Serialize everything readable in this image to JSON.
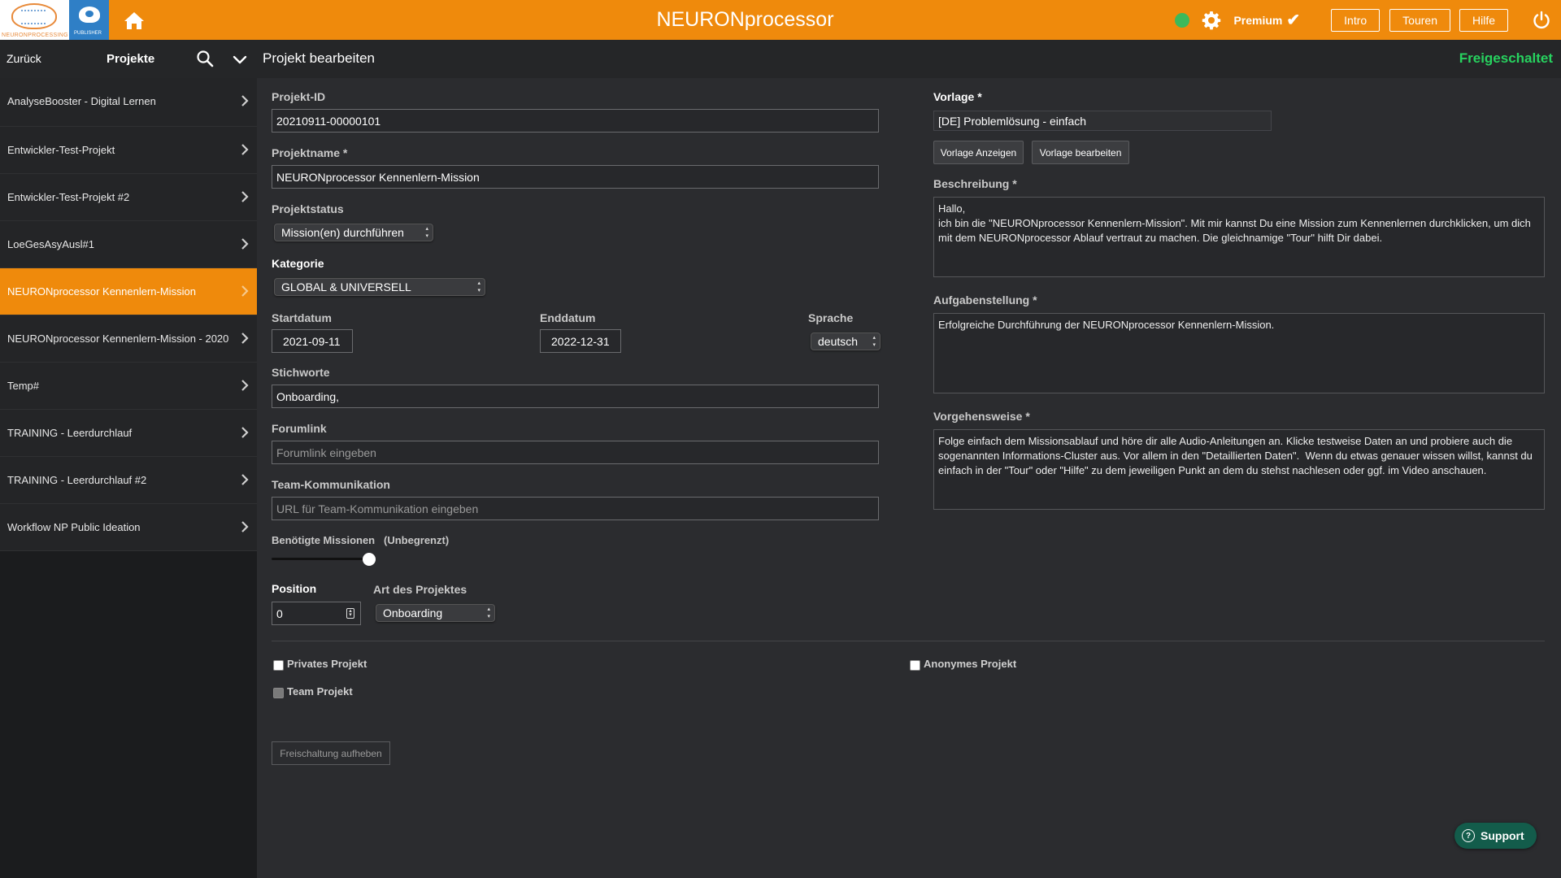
{
  "topbar": {
    "logo_text": "NEURONPROCESSING",
    "publisher_text": "PUBLISHER",
    "title": "NEURONprocessor",
    "premium_label": "Premium",
    "buttons": [
      "Intro",
      "Touren",
      "Hilfe"
    ],
    "status_color": "#3cb95b",
    "accent_color": "#ef8a0c"
  },
  "subbar": {
    "back_label": "Zurück",
    "projects_label": "Projekte",
    "page_title": "Projekt bearbeiten",
    "state_label": "Freigeschaltet",
    "state_color": "#27d25f"
  },
  "sidebar": {
    "items": [
      {
        "label": "AnalyseBooster - Digital Lernen"
      },
      {
        "label": "Entwickler-Test-Projekt"
      },
      {
        "label": "Entwickler-Test-Projekt #2"
      },
      {
        "label": "LoeGesAsyAusl#1"
      },
      {
        "label": "NEURONprocessor Kennenlern-Mission",
        "active": true
      },
      {
        "label": "NEURONprocessor Kennenlern-Mission - 2020"
      },
      {
        "label": "Temp#"
      },
      {
        "label": "TRAINING - Leerdurchlauf"
      },
      {
        "label": "TRAINING - Leerdurchlauf #2"
      },
      {
        "label": "Workflow NP Public Ideation"
      }
    ]
  },
  "form": {
    "project_id": {
      "label": "Projekt-ID",
      "value": "20210911-00000101"
    },
    "project_name": {
      "label": "Projektname *",
      "value": "NEURONprocessor Kennenlern-Mission"
    },
    "project_status": {
      "label": "Projektstatus",
      "value": "Mission(en) durchführen"
    },
    "category": {
      "label": "Kategorie",
      "value": "GLOBAL & UNIVERSELL"
    },
    "start_date": {
      "label": "Startdatum",
      "value": "2021-09-11"
    },
    "end_date": {
      "label": "Enddatum",
      "value": "2022-12-31"
    },
    "language": {
      "label": "Sprache",
      "value": "deutsch"
    },
    "keywords": {
      "label": "Stichworte",
      "value": "Onboarding,"
    },
    "forum_link": {
      "label": "Forumlink",
      "placeholder": "Forumlink eingeben"
    },
    "team_comm": {
      "label": "Team-Kommunikation",
      "placeholder": "URL für Team-Kommunikation eingeben"
    },
    "missions": {
      "label": "Benötigte Missionen",
      "value_label": "(Unbegrenzt)",
      "slider_fraction": 1.0
    },
    "position": {
      "label": "Position",
      "value": "0"
    },
    "project_type": {
      "label": "Art des Projektes",
      "value": "Onboarding"
    },
    "template": {
      "label": "Vorlage *",
      "value": "[DE] Problemlösung - einfach"
    },
    "show_template_label": "Vorlage Anzeigen",
    "edit_template_label": "Vorlage bearbeiten",
    "description": {
      "label": "Beschreibung *",
      "value": "Hallo,\nich bin die \"NEURONprocessor Kennenlern-Mission\". Mit mir kannst Du eine Mission zum Kennenlernen durchklicken, um dich mit dem NEURONprocessor Ablauf vertraut zu machen. Die gleichnamige \"Tour\" hilft Dir dabei."
    },
    "task": {
      "label": "Aufgabenstellung *",
      "value": "Erfolgreiche Durchführung der NEURONprocessor Kennenlern-Mission."
    },
    "procedure": {
      "label": "Vorgehensweise *",
      "value": "Folge einfach dem Missionsablauf und höre dir alle Audio-Anleitungen an. Klicke testweise Daten an und probiere auch die sogenannten Informations-Cluster aus. Vor allem in den \"Detaillierten Daten\".  Wenn du etwas genauer wissen willst, kannst du einfach in der \"Tour\" oder \"Hilfe\" zu dem jeweiligen Punkt an dem du stehst nachlesen oder ggf. im Video anschauen."
    },
    "private_label": "Privates Projekt",
    "anonymous_label": "Anonymes Projekt",
    "team_label": "Team Projekt",
    "unlock_label": "Freischaltung aufheben"
  },
  "support_label": "Support"
}
